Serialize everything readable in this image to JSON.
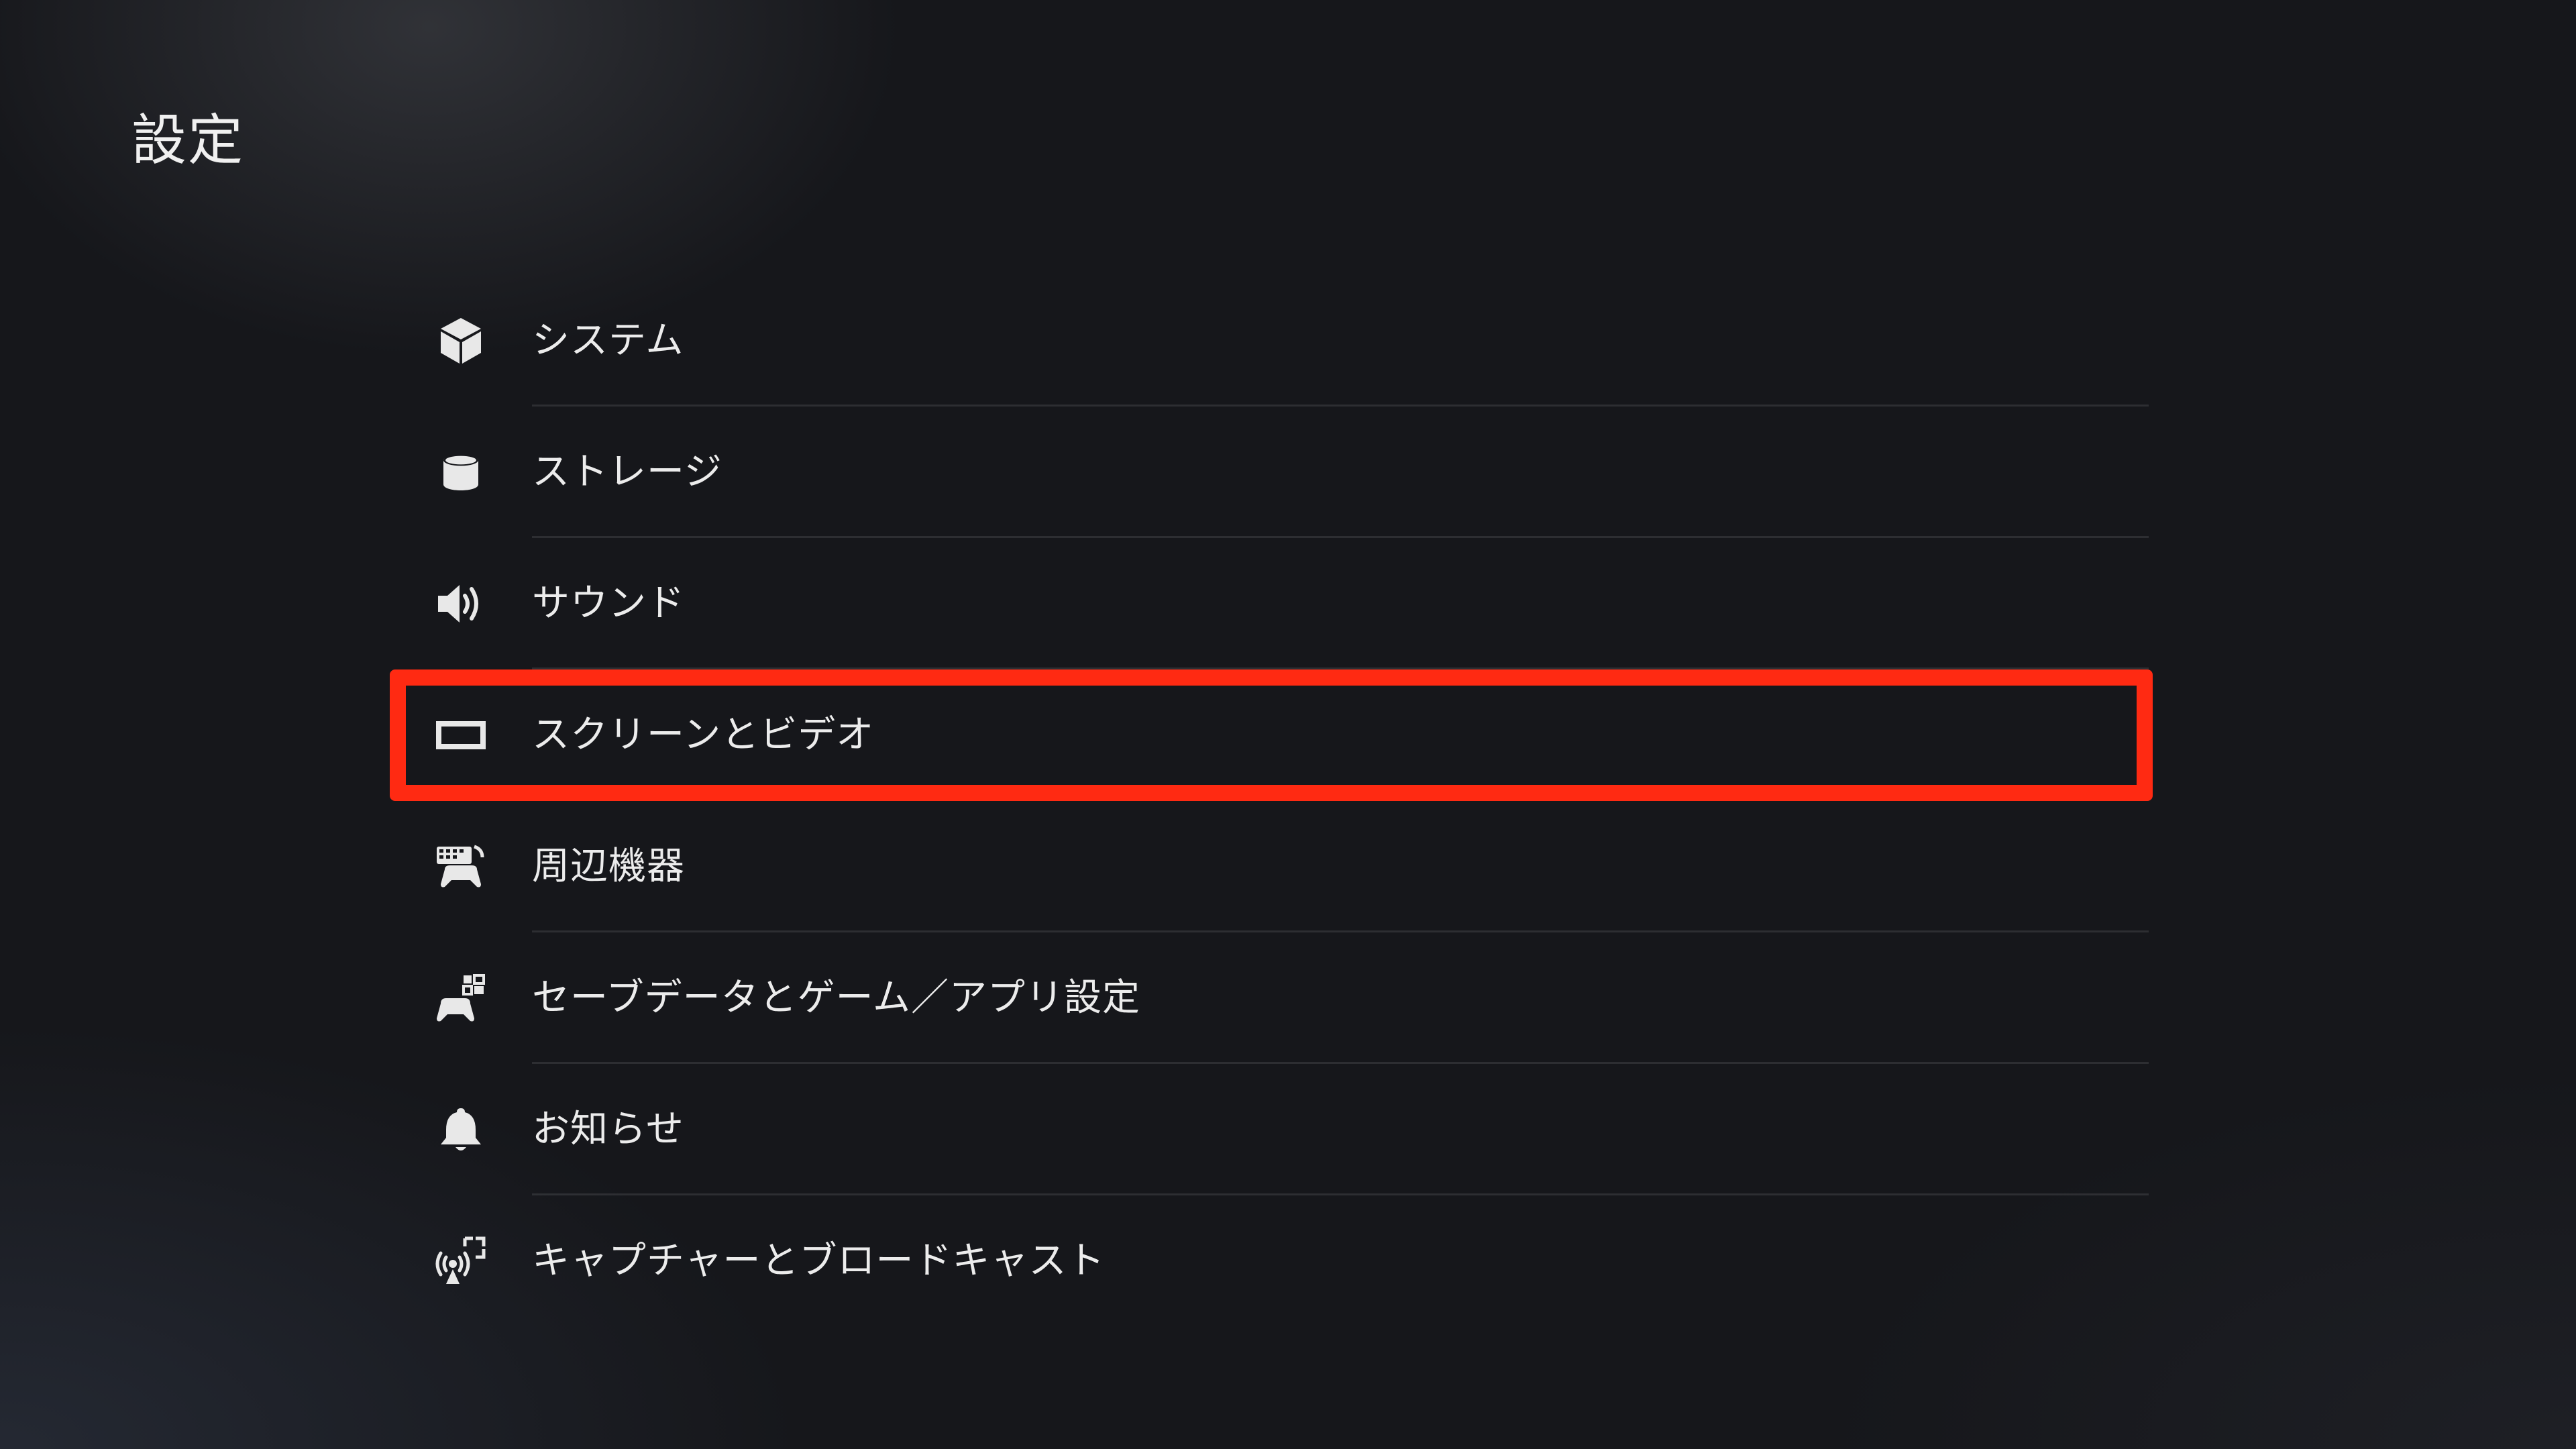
{
  "header": {
    "title": "設定"
  },
  "menu": {
    "items": [
      {
        "label": "システム",
        "icon": "cube-icon"
      },
      {
        "label": "ストレージ",
        "icon": "storage-cylinder-icon"
      },
      {
        "label": "サウンド",
        "icon": "speaker-icon"
      },
      {
        "label": "スクリーンとビデオ",
        "icon": "screen-icon",
        "highlighted": true
      },
      {
        "label": "周辺機器",
        "icon": "keyboard-controller-icon"
      },
      {
        "label": "セーブデータとゲーム／アプリ設定",
        "icon": "controller-grid-icon"
      },
      {
        "label": "お知らせ",
        "icon": "bell-icon"
      },
      {
        "label": "キャプチャーとブロードキャスト",
        "icon": "broadcast-icon"
      }
    ]
  },
  "colors": {
    "background": "#16171b",
    "text": "#ececec",
    "highlight_border": "#ff2a12"
  }
}
